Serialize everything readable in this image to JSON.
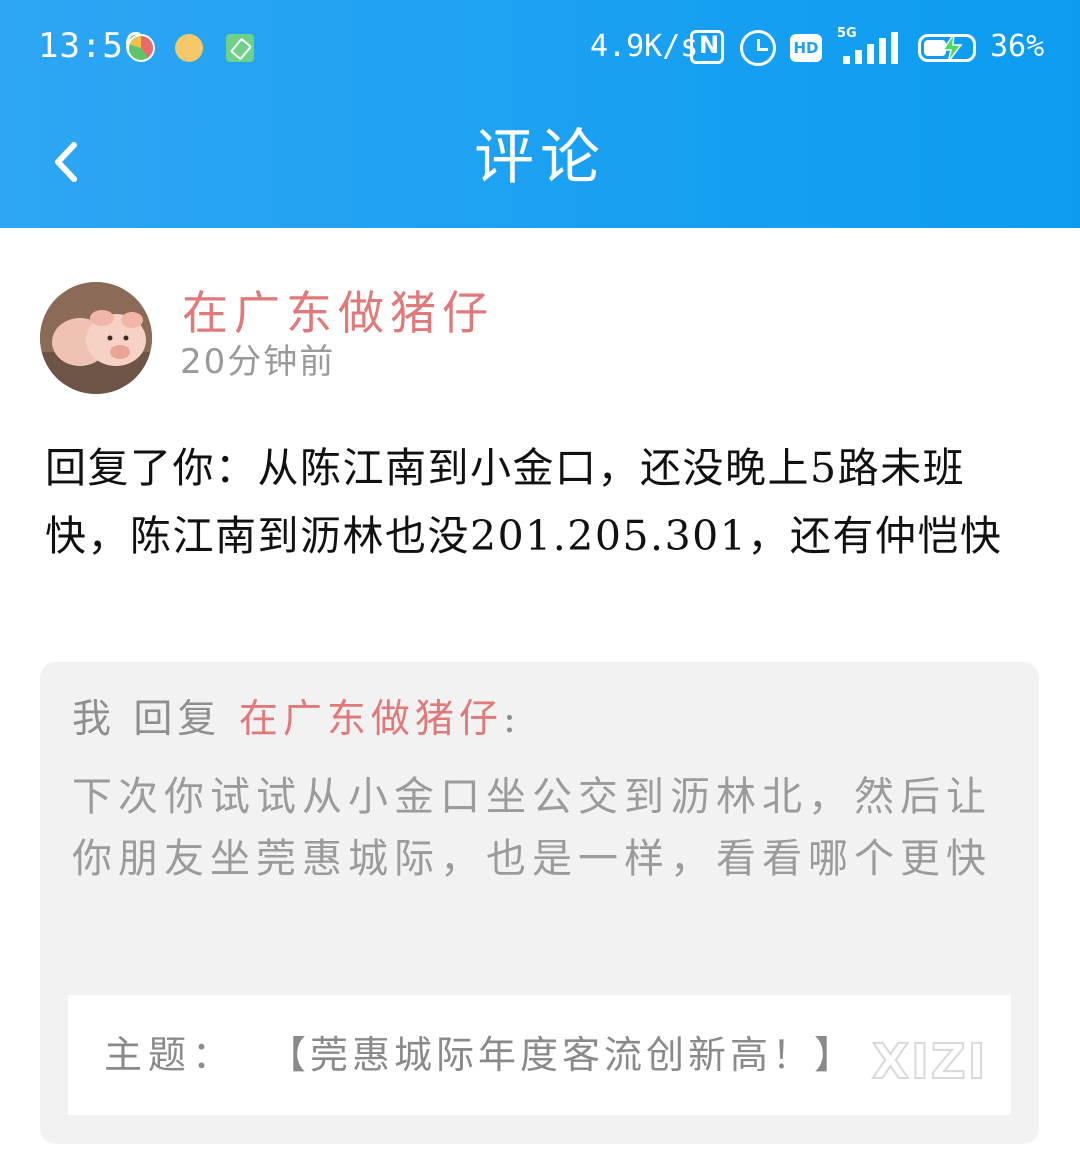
{
  "status_bar": {
    "time": "13:56",
    "net_speed": "4.9K/s",
    "hd_label": "HD",
    "network_type": "5G",
    "battery_percent": "36%",
    "icons": [
      "app-notification-icon",
      "app-notification-icon",
      "tool-icon",
      "nfc-icon",
      "alarm-icon",
      "hd-icon",
      "signal-icon",
      "battery-charging-icon"
    ]
  },
  "header": {
    "title": "评论",
    "back_icon": "chevron-left-icon"
  },
  "comment": {
    "username": "在广东做猪仔",
    "time_ago": "20分钟前",
    "text": "回复了你：从陈江南到小金口，还没晚上5路未班快，陈江南到沥林也没201.205.301，还有仲恺快"
  },
  "my_reply": {
    "author": "我",
    "verb": "回复",
    "target": "在广东做猪仔",
    "colon": ":",
    "text": "下次你试试从小金口坐公交到沥林北，然后让你朋友坐莞惠城际，也是一样，看看哪个更快"
  },
  "topic": {
    "label": "主题：",
    "title": "【莞惠城际年度客流创新高！】"
  },
  "watermark": "XIZI",
  "colors": {
    "header_blue": "#1fa1f2",
    "username_pink": "#e07a7a",
    "card_gray": "#f2f2f2",
    "muted_text": "#9b9b9b"
  }
}
